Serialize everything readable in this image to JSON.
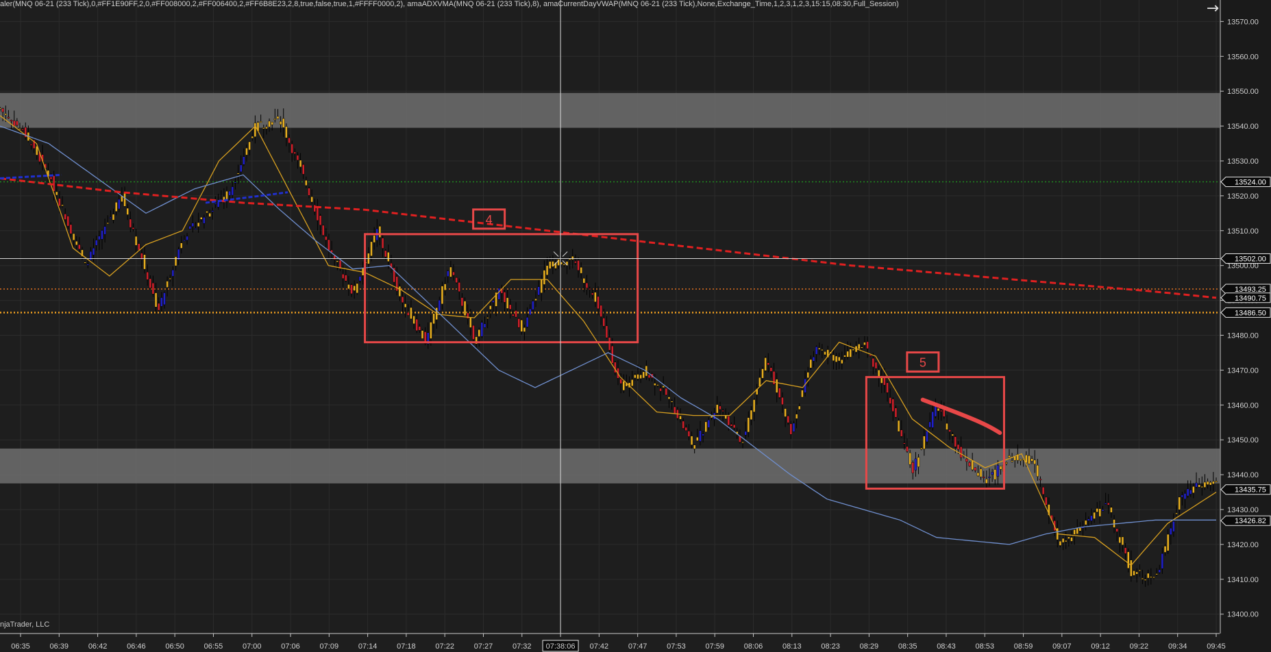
{
  "indicator_line": "aler(MNQ 06-21 (233 Tick),0,#FF1E90FF,2,0,#FF008000,2,#FF006400,2,#FF6B8E23,2,8,true,false,true,1,#FFFF0000,2),  amaADXVMA(MNQ 06-21 (233 Tick),8),  amaCurrentDayVWAP(MNQ 06-21 (233 Tick),None,Exchange_Time,1,2,3,1,2,3,15:15,08:30,Full_Session)",
  "copyright": "njaTrader, LLC",
  "arrow_icon": "arrow-right-icon",
  "colors": {
    "background": "#1e1e1e",
    "axis_bg": "#1a1a1a",
    "zone": "#6e6e6e",
    "candle_down": "#d0202a",
    "candle_up": "#2020c8",
    "candle_neutral": "#e8b020",
    "adxvma": "#d8a020",
    "vwap": "#7090d0",
    "regression": "#e02020",
    "annotation": "#e84848"
  },
  "chart_data": {
    "type": "line",
    "title": "",
    "xlabel": "",
    "ylabel": "",
    "ylim": [
      13397,
      13574
    ],
    "x_tick_labels": [
      "06:35",
      "06:39",
      "06:42",
      "06:46",
      "06:50",
      "06:55",
      "07:00",
      "07:06",
      "07:09",
      "07:14",
      "07:18",
      "07:22",
      "07:27",
      "07:32",
      "07:38:06",
      "07:42",
      "07:47",
      "07:53",
      "07:59",
      "08:06",
      "08:13",
      "08:23",
      "08:29",
      "08:35",
      "08:43",
      "08:53",
      "08:59",
      "09:07",
      "09:12",
      "09:22",
      "09:34",
      "09:45"
    ],
    "y_tick_labels": [
      13400,
      13410,
      13420,
      13430,
      13440,
      13450,
      13460,
      13470,
      13480,
      13490,
      13500,
      13510,
      13520,
      13530,
      13540,
      13550,
      13560,
      13570
    ],
    "price_markers": [
      {
        "label": "13524.00",
        "value": 13524.0,
        "color": "#1f8a1f",
        "style": "dotted"
      },
      {
        "label": "13502.00",
        "value": 13502.0,
        "color": "#ffffff",
        "style": "solid"
      },
      {
        "label": "13493.25",
        "value": 13493.25,
        "color": "#e07020",
        "style": "dotted"
      },
      {
        "label": "13490.75",
        "value": 13490.75,
        "color": "#e02020",
        "style": "none"
      },
      {
        "label": "13486.50",
        "value": 13486.5,
        "color": "#f0a020",
        "style": "dotted"
      },
      {
        "label": "13435.75",
        "value": 13435.75,
        "color": "#d8a020",
        "style": "none"
      },
      {
        "label": "13426.82",
        "value": 13426.82,
        "color": "#7090d0",
        "style": "none"
      }
    ],
    "crosshair": {
      "time_label": "07:38:06",
      "price": 13502.0
    },
    "zones": [
      {
        "from": 13539.5,
        "to": 13549.5
      },
      {
        "from": 13437.5,
        "to": 13447.5
      }
    ],
    "series": [
      {
        "name": "",
        "kind": "price",
        "x": [
          0,
          0.02,
          0.04,
          0.07,
          0.1,
          0.13,
          0.15,
          0.17,
          0.19,
          0.21,
          0.23,
          0.25,
          0.27,
          0.29,
          0.31,
          0.33,
          0.35,
          0.37,
          0.39,
          0.41,
          0.43,
          0.45,
          0.47,
          0.49,
          0.51,
          0.53,
          0.55,
          0.57,
          0.59,
          0.61,
          0.63,
          0.65,
          0.67,
          0.69,
          0.71,
          0.73,
          0.75,
          0.77,
          0.79,
          0.81,
          0.83,
          0.85,
          0.87,
          0.89,
          0.91,
          0.93,
          0.95,
          0.97,
          0.985,
          1.0
        ],
        "y": [
          13545,
          13538,
          13526,
          13500,
          13520,
          13487,
          13508,
          13515,
          13522,
          13540,
          13542,
          13525,
          13505,
          13492,
          13510,
          13490,
          13478,
          13500,
          13478,
          13493,
          13481,
          13500,
          13502,
          13490,
          13465,
          13470,
          13462,
          13448,
          13460,
          13449,
          13474,
          13452,
          13476,
          13473,
          13478,
          13463,
          13441,
          13460,
          13446,
          13438,
          13445,
          13444,
          13420,
          13425,
          13432,
          13412,
          13410,
          13433,
          13437,
          13438
        ]
      },
      {
        "name": "",
        "kind": "adxvma",
        "x": [
          0,
          0.03,
          0.06,
          0.09,
          0.12,
          0.15,
          0.18,
          0.21,
          0.24,
          0.27,
          0.3,
          0.33,
          0.36,
          0.39,
          0.42,
          0.45,
          0.48,
          0.51,
          0.54,
          0.57,
          0.6,
          0.63,
          0.66,
          0.69,
          0.72,
          0.75,
          0.78,
          0.81,
          0.84,
          0.87,
          0.9,
          0.93,
          0.96,
          1.0
        ],
        "y": [
          13543,
          13535,
          13505,
          13497,
          13506,
          13510,
          13530,
          13540,
          13520,
          13500,
          13498,
          13493,
          13486,
          13485,
          13496,
          13496,
          13484,
          13468,
          13458,
          13457,
          13457,
          13467,
          13465,
          13478,
          13474,
          13456,
          13448,
          13442,
          13446,
          13423,
          13422,
          13414,
          13426,
          13435
        ]
      },
      {
        "name": "",
        "kind": "vwap",
        "x": [
          0,
          0.04,
          0.08,
          0.12,
          0.16,
          0.2,
          0.23,
          0.26,
          0.29,
          0.32,
          0.35,
          0.38,
          0.41,
          0.44,
          0.47,
          0.5,
          0.53,
          0.56,
          0.59,
          0.62,
          0.65,
          0.68,
          0.71,
          0.74,
          0.77,
          0.8,
          0.83,
          0.86,
          0.89,
          0.92,
          0.95,
          0.98,
          1.0
        ],
        "y": [
          13540,
          13535,
          13525,
          13515,
          13522,
          13526,
          13516,
          13507,
          13499,
          13500,
          13490,
          13480,
          13470,
          13465,
          13470,
          13475,
          13470,
          13462,
          13456,
          13448,
          13440,
          13433,
          13430,
          13427,
          13422,
          13421,
          13420,
          13423,
          13425,
          13426,
          13427,
          13427,
          13427
        ]
      },
      {
        "name": "",
        "kind": "regression",
        "x": [
          0,
          0.05,
          0.1,
          0.15,
          0.2,
          0.25,
          0.3,
          0.35,
          0.4,
          0.45,
          0.5,
          0.55,
          0.6,
          0.65,
          0.7,
          0.75,
          0.8,
          0.85,
          0.9,
          0.95,
          1.0
        ],
        "y": [
          13525,
          13523,
          13521,
          13519.5,
          13518,
          13517,
          13516,
          13514,
          13512,
          13510,
          13508,
          13506,
          13504,
          13502,
          13500,
          13498.5,
          13497,
          13495.5,
          13494,
          13492.5,
          13490.75
        ]
      }
    ],
    "annotations": [
      {
        "label": "4",
        "time_from": "07:14",
        "time_to": "07:47",
        "price_from": 13478,
        "price_to": 13509
      },
      {
        "label": "5",
        "time_from": "08:29",
        "time_to": "08:56",
        "price_from": 13436,
        "price_to": 13468
      }
    ],
    "grid": true
  }
}
